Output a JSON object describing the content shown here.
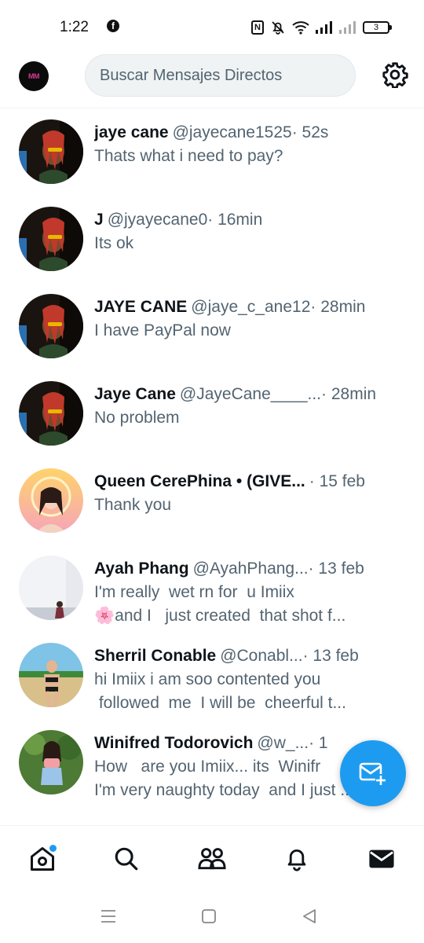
{
  "status_bar": {
    "time": "1:22",
    "battery": "3"
  },
  "header": {
    "avatar_text": "MM",
    "search_placeholder": "Buscar Mensajes Directos"
  },
  "conversations": [
    {
      "name": "jaye cane",
      "handle": "@jayecane1525",
      "time": "· 52s",
      "message": "Thats what i need to pay?",
      "avatar": "portrait-man-red-braids"
    },
    {
      "name": "J",
      "handle": "@jyayecane0",
      "time": "· 16min",
      "message": "Its ok",
      "avatar": "portrait-man-red-braids"
    },
    {
      "name": "JAYE CANE",
      "handle": "@jaye_c_ane12",
      "time": "· 28min",
      "message": "I have PayPal now",
      "avatar": "portrait-man-red-braids"
    },
    {
      "name": "Jaye Cane",
      "handle": "@JayeCane____...",
      "time": "· 28min",
      "message": "No problem",
      "avatar": "portrait-man-red-braids"
    },
    {
      "name": "Queen CerePhina • (GIVE...",
      "handle": "",
      "time": " · 15 feb",
      "message": "Thank you",
      "avatar": "portrait-woman-halo"
    },
    {
      "name": "Ayah Phang",
      "handle": "@AyahPhang...",
      "time": " · 13 feb",
      "message": "I'm really  wet rn for  u Imiix\n🌸and I   just created  that shot f...",
      "avatar": "photo-woman-wall"
    },
    {
      "name": "Sherril Conable",
      "handle": "@Conabl...",
      "time": " · 13 feb",
      "message": "hi Imiix i am soo contented you\n followed  me  I will be  cheerful t...",
      "avatar": "photo-woman-beach"
    },
    {
      "name": "Winifred Todorovich",
      "handle": "@w_...",
      "time": " · 1",
      "message": "How   are you Imiix... its  Winifr\nI'm very naughty today  and I just ...",
      "avatar": "photo-woman-garden"
    }
  ],
  "colors": {
    "accent": "#1d9bf0",
    "text_primary": "#0f1419",
    "text_secondary": "#536471",
    "divider": "#eff3f4"
  },
  "nav": [
    "home-icon",
    "search-icon",
    "communities-icon",
    "notifications-icon",
    "messages-icon"
  ]
}
